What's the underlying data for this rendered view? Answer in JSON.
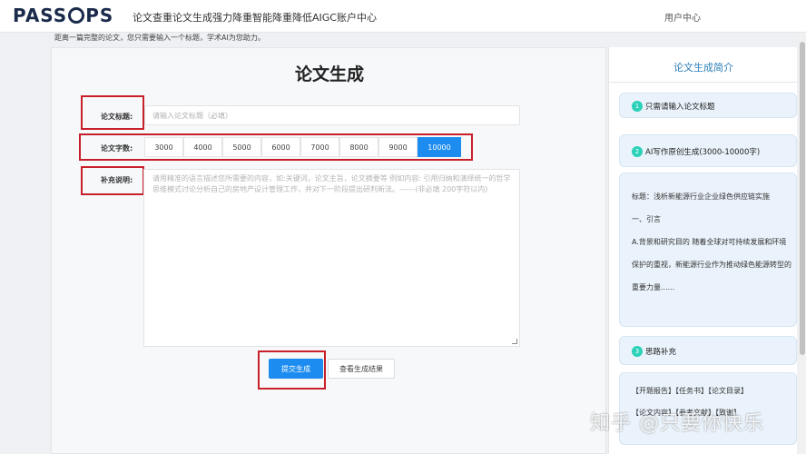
{
  "header": {
    "logo_text_1": "PASS",
    "logo_text_2": "PS",
    "nav_items": [
      "论文查重",
      "论文生成",
      "强力降重",
      "智能降重",
      "降低AIGC",
      "账户中心"
    ],
    "user_center": "用户中心"
  },
  "intro": "距离一篇完整的论文，您只需要输入一个标题，学术AI为您助力。",
  "form": {
    "title": "论文生成",
    "paper_title_label": "论文标题:",
    "paper_title_placeholder": "请输入论文标题（必填）",
    "word_count_label": "论文字数:",
    "word_counts": [
      "3000",
      "4000",
      "5000",
      "6000",
      "7000",
      "8000",
      "9000",
      "10000"
    ],
    "word_count_selected": "10000",
    "supplement_label": "补充说明:",
    "supplement_placeholder": "请用精准的语言描述您所需要的内容，如:关键词，论文主旨，论文摘要等 例如内容: 引用归纳和演绎统一的哲学思维模式讨论分析自己的房地产设计管理工作，并对下一阶段提出研判新法。------(非必填 200字符以内)",
    "submit_label": "提交生成",
    "view_result_label": "查看生成结果"
  },
  "sidebar": {
    "title": "论文生成简介",
    "steps": [
      {
        "num": "1",
        "text": "只需请输入论文标题"
      },
      {
        "num": "2",
        "text": "AI写作原创生成(3000-10000字)"
      },
      {
        "num": "3",
        "text": "思路补充"
      }
    ],
    "example_lines": [
      "标题：浅析新能源行业企业绿色供应链实施",
      "一、引言",
      "A.背景和研究目的 随着全球对可持续发展和环境",
      "保护的重视，新能源行业作为推动绿色能源转型的",
      "重要力量......"
    ],
    "bottom_tags": "【开题报告】【任务书】【论文目录】",
    "bottom_tags_2": "【论文内容】【参考文献】【致谢】"
  },
  "watermark": "知乎 @只要你快乐",
  "colors": {
    "accent": "#1c8cf0",
    "highlight_box": "#c8202a",
    "step_badge": "#2bd1b8"
  }
}
